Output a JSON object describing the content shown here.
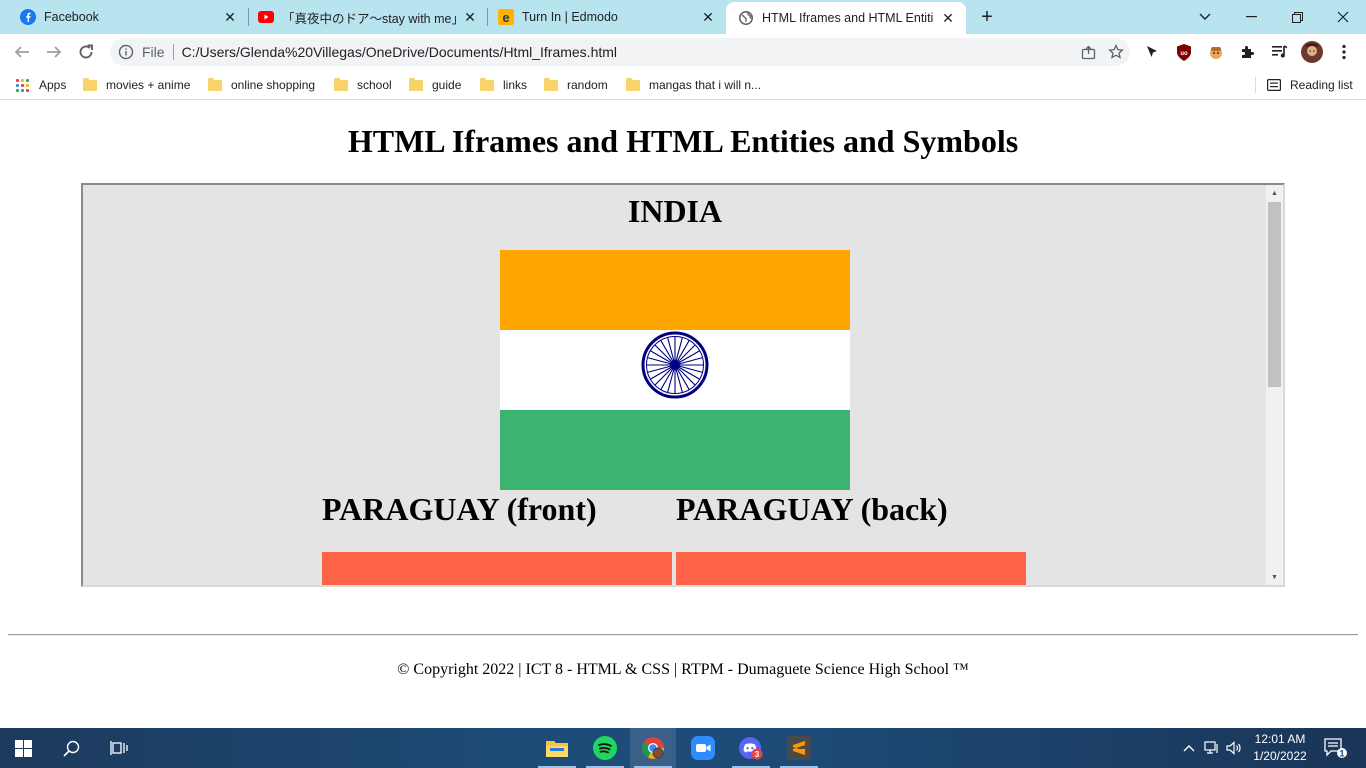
{
  "browser": {
    "tabs": [
      {
        "title": "Facebook",
        "icon": "facebook-icon"
      },
      {
        "title": "「真夜中のドア〜stay with me」/ 松",
        "icon": "youtube-icon"
      },
      {
        "title": "Turn In | Edmodo",
        "icon": "edmodo-icon"
      },
      {
        "title": "HTML Iframes and HTML Entities",
        "icon": "globe-icon",
        "active": true
      }
    ],
    "new_tab_symbol": "+",
    "address": {
      "scheme_label": "File",
      "url": "C:/Users/Glenda%20Villegas/OneDrive/Documents/Html_Iframes.html"
    },
    "bookmarks": [
      {
        "label": "Apps"
      },
      {
        "label": "movies + anime"
      },
      {
        "label": "online shopping"
      },
      {
        "label": "school"
      },
      {
        "label": "guide"
      },
      {
        "label": "links"
      },
      {
        "label": "random"
      },
      {
        "label": "mangas that i will n..."
      }
    ],
    "reading_list_label": "Reading list"
  },
  "page": {
    "title": "HTML Iframes and HTML Entities and Symbols",
    "iframe": {
      "sections": [
        {
          "heading": "INDIA",
          "flag_colors": [
            "#ffa500",
            "#ffffff",
            "#3cb371"
          ],
          "emblem_color": "#000080"
        },
        {
          "heading": "PARAGUAY (front)",
          "flag_color": "#ff6347"
        },
        {
          "heading": "PARAGUAY (back)",
          "flag_color": "#ff6347"
        }
      ]
    },
    "footer": "© Copyright 2022 | ICT 8 - HTML & CSS | RTPM - Dumaguete Science High School ™"
  },
  "taskbar": {
    "apps": [
      "file-explorer-icon",
      "spotify-icon",
      "chrome-icon",
      "zoom-icon",
      "discord-icon",
      "sublime-text-icon"
    ],
    "discord_badge": "3",
    "notification_badge": "1",
    "time": "12:01 AM",
    "date": "1/20/2022"
  }
}
